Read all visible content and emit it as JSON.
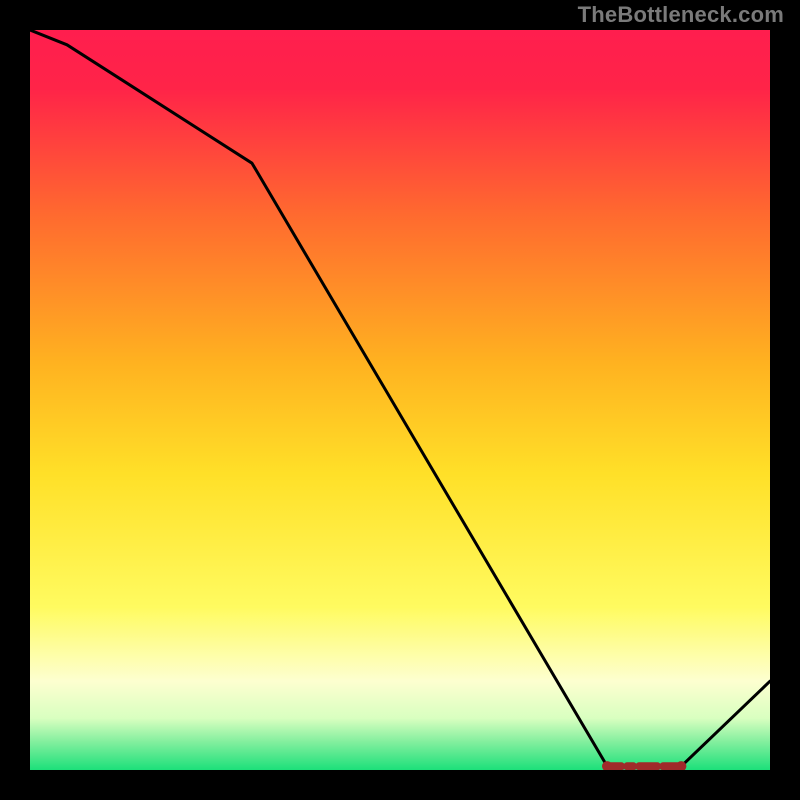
{
  "attribution": "TheBottleneck.com",
  "chart_data": {
    "type": "line",
    "title": "",
    "xlabel": "",
    "ylabel": "",
    "xlim": [
      0,
      100
    ],
    "ylim": [
      0,
      100
    ],
    "grid": false,
    "legend": false,
    "x": [
      0,
      5,
      30,
      78,
      88,
      100
    ],
    "values": [
      103,
      98,
      82,
      0.5,
      0.5,
      12
    ],
    "marker_region": {
      "x_start": 78,
      "x_end": 88,
      "y": 0.5,
      "color": "#a02a2a"
    },
    "background_gradient": {
      "top": "#ff1a4a",
      "mid_upper": "#ff8a2a",
      "mid": "#ffe12a",
      "mid_lower": "#ffff7a",
      "band_pale": "#fdffe0",
      "bottom": "#1ce07a"
    }
  }
}
